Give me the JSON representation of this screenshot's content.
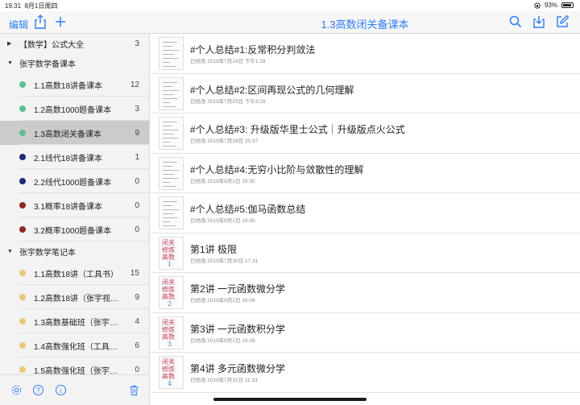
{
  "status": {
    "time": "19:31",
    "date": "8月1日周四",
    "battery": "93%"
  },
  "nav": {
    "edit_label": "编辑",
    "title": "1.3高数闭关备课本"
  },
  "sidebar": {
    "rows": [
      {
        "kind": "group",
        "label": "【数学】公式大全",
        "count": "3",
        "expanded": false
      },
      {
        "kind": "group",
        "label": "张宇数学备课本",
        "count": "",
        "expanded": true
      },
      {
        "kind": "item",
        "label": "1.1高数18讲备课本",
        "count": "12",
        "color": "#5fbf8f"
      },
      {
        "kind": "item",
        "label": "1.2高数1000题备课本",
        "count": "3",
        "color": "#5fbf8f"
      },
      {
        "kind": "item",
        "label": "1.3高数闭关备课本",
        "count": "9",
        "color": "#5fbf8f",
        "selected": true
      },
      {
        "kind": "item",
        "label": "2.1线代18讲备课本",
        "count": "1",
        "color": "#1f2a78"
      },
      {
        "kind": "item",
        "label": "2.2线代1000题备课本",
        "count": "0",
        "color": "#1f2a78"
      },
      {
        "kind": "item",
        "label": "3.1概率18讲备课本",
        "count": "0",
        "color": "#8e2a25"
      },
      {
        "kind": "item",
        "label": "3.2概率1000题备课本",
        "count": "0",
        "color": "#8e2a25"
      },
      {
        "kind": "group",
        "label": "张宇数学笔记本",
        "count": "",
        "expanded": true
      },
      {
        "kind": "item",
        "label": "1.1高数18讲（工具书）",
        "count": "15",
        "color": "#e9c877"
      },
      {
        "kind": "item",
        "label": "1.2高数18讲（张宇视频…",
        "count": "9",
        "color": "#e9c877"
      },
      {
        "kind": "item",
        "label": "1.3高数基础班（张宇视…",
        "count": "4",
        "color": "#e9c877"
      },
      {
        "kind": "item",
        "label": "1.4高数强化班（工具书）",
        "count": "6",
        "color": "#e9c877"
      },
      {
        "kind": "item",
        "label": "1.5高数强化班（张宇视…",
        "count": "0",
        "color": "#e9c877"
      }
    ]
  },
  "notes": [
    {
      "title": "#个人总结#1:反常积分判敛法",
      "date": "已修改 2019年7月24日 下午1:28",
      "thumb": "doc"
    },
    {
      "title": "#个人总结#2:区间再现公式的几何理解",
      "date": "已修改 2019年7月25日 下午3:29",
      "thumb": "doc"
    },
    {
      "title": "#个人总结#3: 升级版华里士公式｜升级版点火公式",
      "date": "已修改 2019年7月28日 20:37",
      "thumb": "doc"
    },
    {
      "title": "#个人总结#4:无穷小比阶与敛散性的理解",
      "date": "已修改 2019年8月1日 19:30",
      "thumb": "doc"
    },
    {
      "title": "#个人总结#5:伽马函数总结",
      "date": "已修改 2019年8月1日 19:30",
      "thumb": "doc"
    },
    {
      "title": "第1讲 极限",
      "date": "已修改 2019年7月30日 17:31",
      "thumb": "cover",
      "cover": [
        "闭关",
        "修炼",
        "高数",
        "1"
      ]
    },
    {
      "title": "第2讲 一元函数微分学",
      "date": "已修改 2019年8月1日 16:04",
      "thumb": "cover",
      "cover": [
        "闭关",
        "修炼",
        "高数",
        "2"
      ]
    },
    {
      "title": "第3讲 一元函数积分学",
      "date": "已修改 2019年8月1日 19:28",
      "thumb": "cover",
      "cover": [
        "闭关",
        "修炼",
        "高数",
        "3"
      ]
    },
    {
      "title": "第4讲 多元函数微分学",
      "date": "已修改 2019年7月31日 11:33",
      "thumb": "cover",
      "cover": [
        "闭关",
        "修炼",
        "高数",
        "4"
      ]
    }
  ],
  "icons": {
    "share": "share-icon",
    "add": "plus-icon",
    "search": "search-icon",
    "export": "export-icon",
    "compose": "compose-icon",
    "settings": "gear-icon",
    "help": "help-icon",
    "info": "info-icon",
    "trash": "trash-icon"
  },
  "colors": {
    "accent": "#2f7df6",
    "selected_row": "#cbcbcb"
  }
}
